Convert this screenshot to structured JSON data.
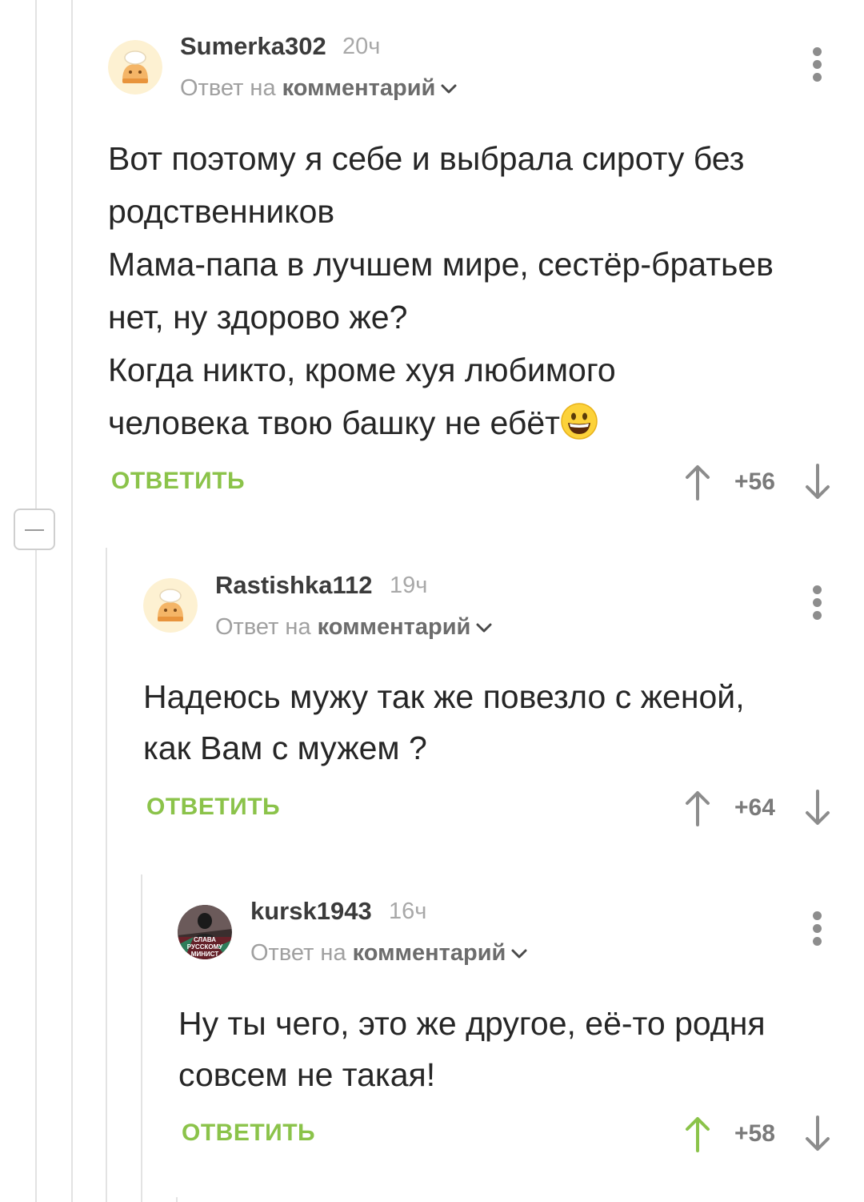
{
  "comments": [
    {
      "username": "Sumerka302",
      "time": "20ч",
      "reply_prefix": "Ответ на",
      "reply_link": "комментарий",
      "lines": [
        "Вот поэтому я себе и выбрала сироту без",
        "родственников",
        "Мама-папа в лучшем мире, сестёр-братьев",
        "нет,  ну здорово же?",
        "Когда никто, кроме хуя любимого",
        "человека твою башку не ебёт"
      ],
      "reply_label": "ОТВЕТИТЬ",
      "score": "+56",
      "upvoted": false,
      "avatar": "default-avatar-icon"
    },
    {
      "username": "Rastishka112",
      "time": "19ч",
      "reply_prefix": "Ответ на",
      "reply_link": "комментарий",
      "lines": [
        "Надеюсь мужу так же повезло с женой,",
        "как Вам с мужем ?"
      ],
      "reply_label": "ОТВЕТИТЬ",
      "score": "+64",
      "upvoted": false,
      "avatar": "default-avatar-icon"
    },
    {
      "username": "kursk1943",
      "time": "16ч",
      "reply_prefix": "Ответ на",
      "reply_link": "комментарий",
      "lines": [
        "Ну ты чего, это же другое, её-то родня",
        "совсем не такая!"
      ],
      "reply_label": "ОТВЕТИТЬ",
      "score": "+58",
      "upvoted": true,
      "avatar": "user-photo-avatar",
      "avatar_text": [
        "СЛАВА",
        "РУССКОМУ",
        "МИНИСТ"
      ]
    }
  ],
  "colors": {
    "accent": "#8bc34a",
    "upvote_active": "#8bc34a",
    "thread_line": "#e3e3e3",
    "muted": "#a0a0a0"
  }
}
